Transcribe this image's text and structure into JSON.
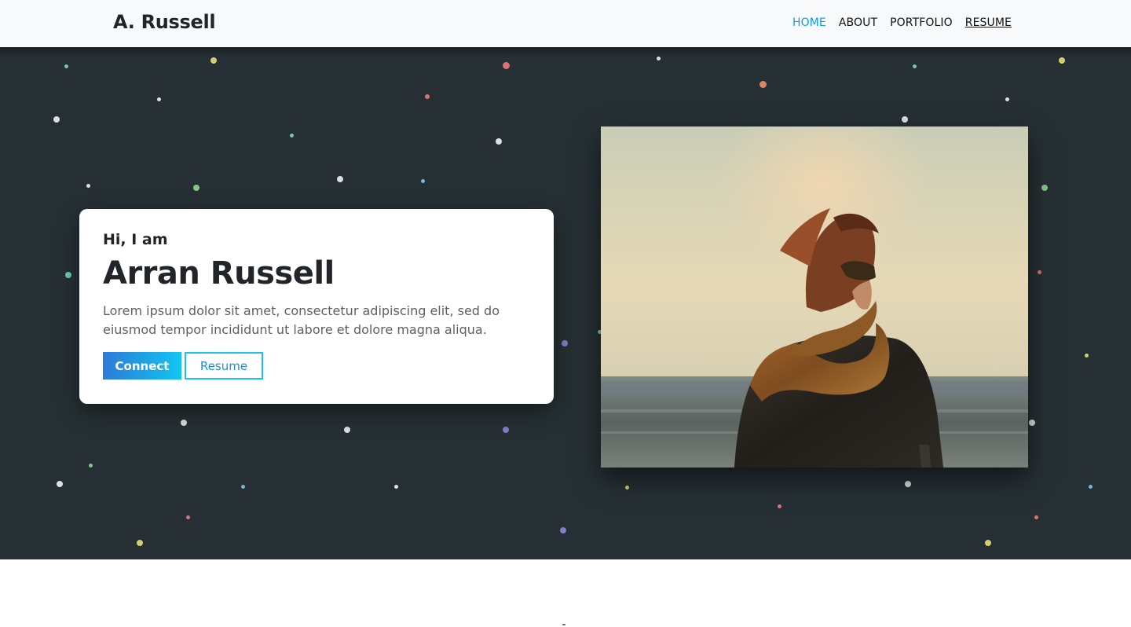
{
  "navbar": {
    "brand": "A. Russell",
    "links": [
      {
        "label": "HOME"
      },
      {
        "label": "ABOUT"
      },
      {
        "label": "PORTFOLIO"
      },
      {
        "label": "RESUME"
      }
    ]
  },
  "hero": {
    "greeting": "Hi, I am",
    "name": "Arran Russell",
    "bio": "Lorem ipsum dolor sit amet, consectetur adipiscing elit, sed do eiusmod tempor incididunt ut labore et dolore magna aliqua.",
    "connect_label": "Connect",
    "resume_label": "Resume",
    "photo_subject": "person-with-scarf-facing-sea"
  },
  "colors": {
    "accent": "#0d9be6",
    "hero_background": "#263034",
    "button_gradient_start": "#2e7ad6",
    "button_gradient_end": "#10c6f2",
    "particles": [
      "#ffffff",
      "#e8e07a",
      "#f07a7a",
      "#7ed6c6",
      "#8fd88f",
      "#7ac8f0",
      "#8e86d6",
      "#f0906a"
    ]
  }
}
